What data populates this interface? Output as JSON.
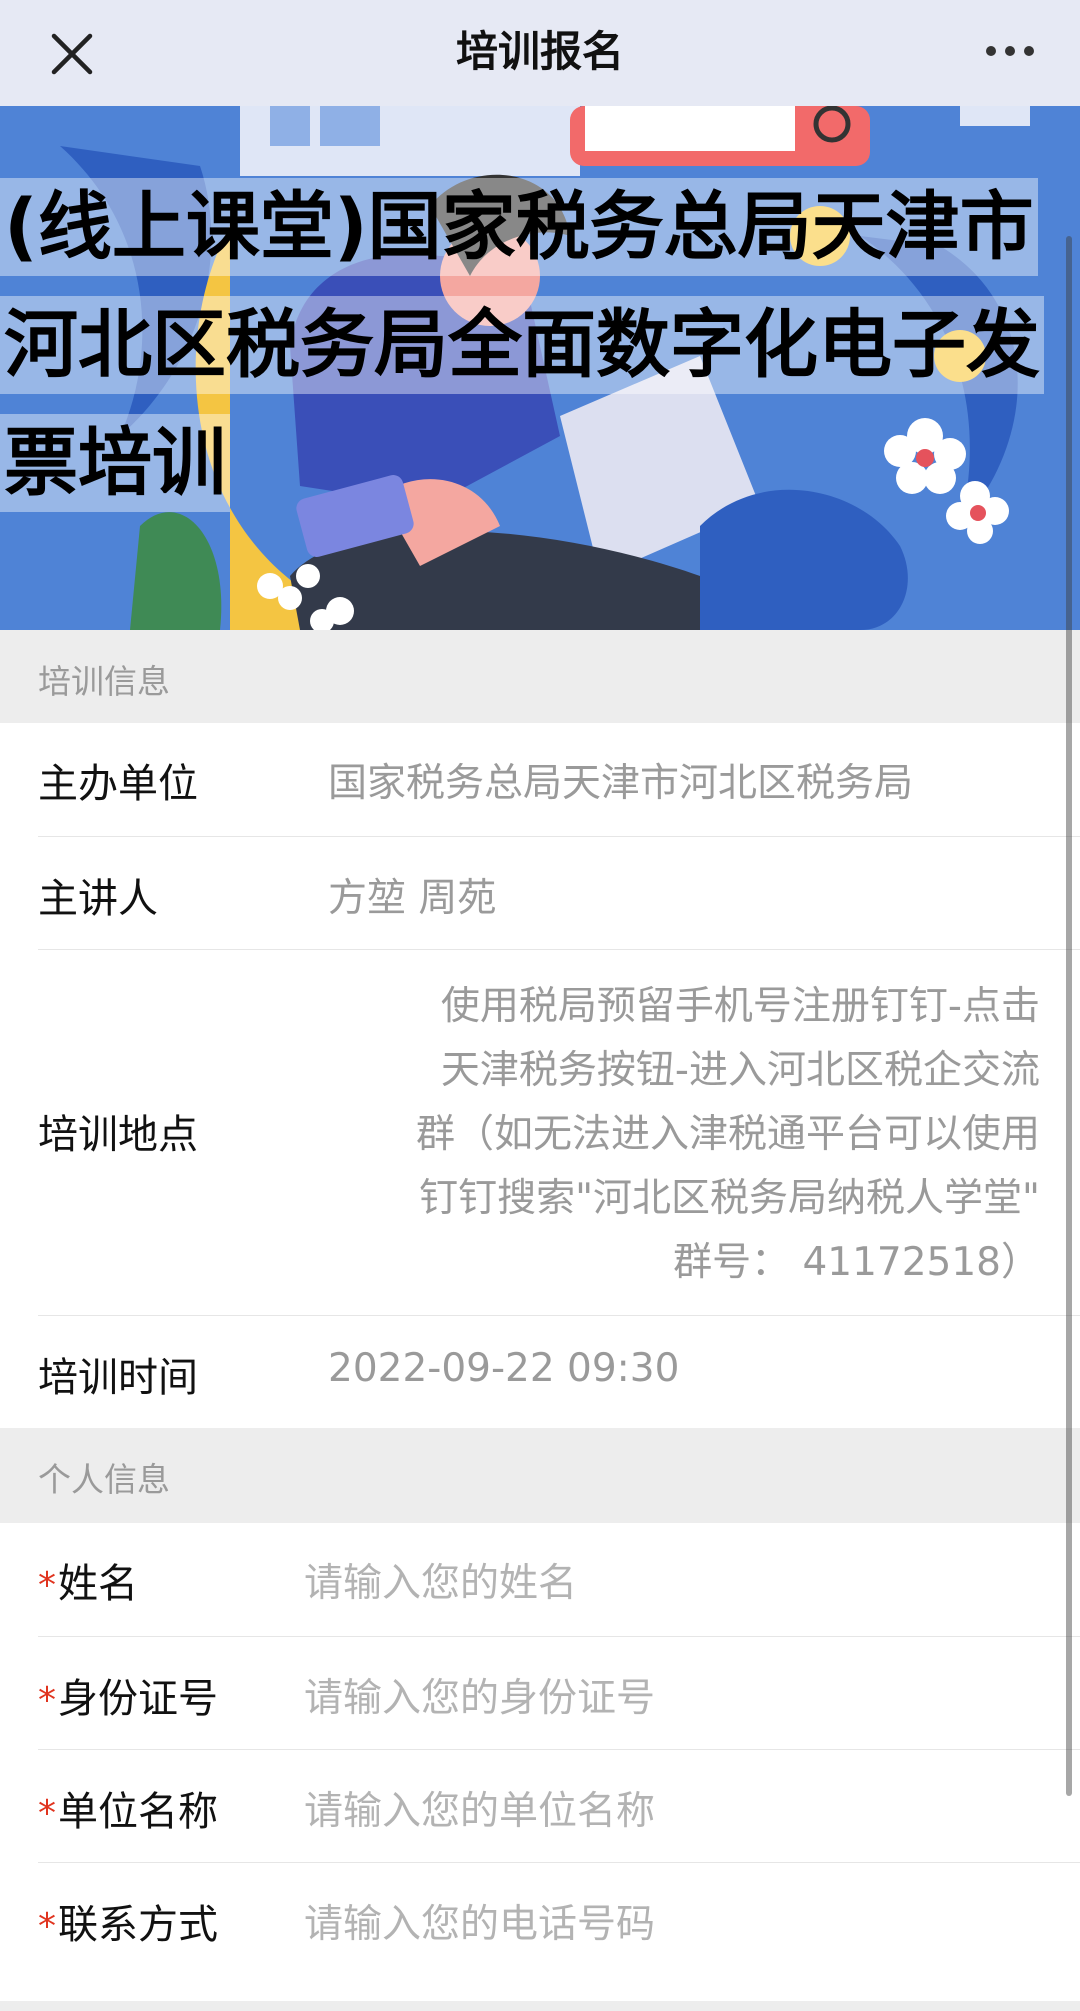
{
  "nav": {
    "title": "培训报名",
    "close_icon": "close-icon",
    "more_icon": "more-dots-icon"
  },
  "banner": {
    "title_lines": [
      "(线上课堂)国家税务总局天津市",
      "河北区税务局全面数字化电子发",
      "票培训"
    ]
  },
  "training_info": {
    "section_title": "培训信息",
    "host_label": "主办单位",
    "host_value": "国家税务总局天津市河北区税务局",
    "speaker_label": "主讲人",
    "speaker_value": "方堃 周苑",
    "location_label": "培训地点",
    "location_lines": [
      "使用税局预留手机号注册钉钉-点击",
      "天津税务按钮-进入河北区税企交流",
      "群（如无法进入津税通平台可以使用",
      "钉钉搜索\"河北区税务局纳税人学堂\"",
      "群号：  41172518）"
    ],
    "time_label": "培训时间",
    "time_value": "2022-09-22 09:30"
  },
  "personal_info": {
    "section_title": "个人信息",
    "required_mark": "*",
    "fields": [
      {
        "label": "姓名",
        "placeholder": "请输入您的姓名"
      },
      {
        "label": "身份证号",
        "placeholder": "请输入您的身份证号"
      },
      {
        "label": "单位名称",
        "placeholder": "请输入您的单位名称"
      },
      {
        "label": "联系方式",
        "placeholder": "请输入您的电话号码"
      }
    ]
  },
  "colors": {
    "navbar_bg": "#e6e9f4",
    "required": "#e0341f",
    "banner_blue": "#4f83d6"
  }
}
